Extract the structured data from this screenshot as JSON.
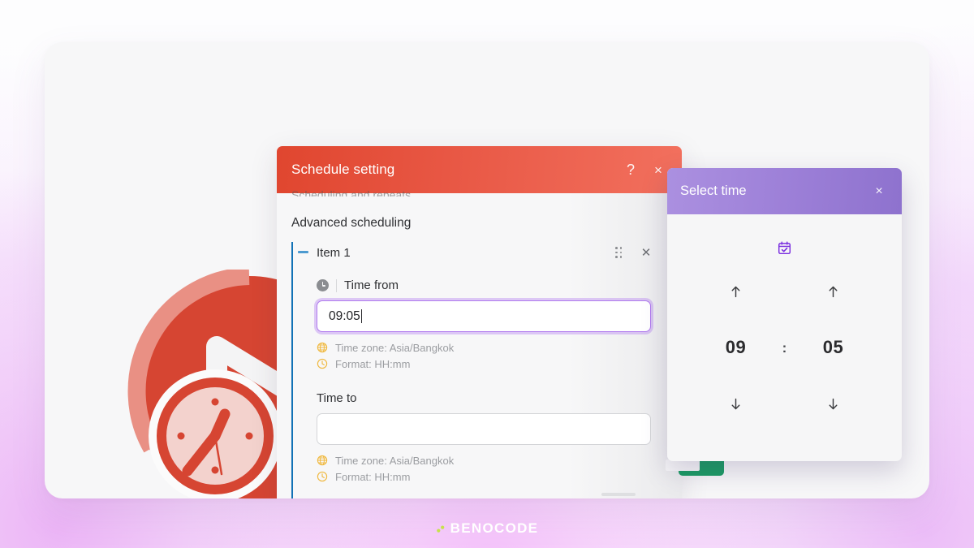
{
  "brand": {
    "name": "BENOCODE",
    "mark_icon": "benocode-dots-icon",
    "accent_color": "#c6e24a"
  },
  "background": {
    "logo_icon": "clock-logo-icon",
    "logo_color": "#d64532"
  },
  "schedule_dialog": {
    "title": "Schedule setting",
    "help_label": "?",
    "close_label": "×",
    "header_color_start": "#e0462f",
    "header_color_end": "#f2705e",
    "clipped_text": "Scheduling and repeats",
    "section_title": "Advanced scheduling",
    "item": {
      "label": "Item 1",
      "collapse_icon": "collapse-dash-icon",
      "drag_icon": "drag-handle-icon",
      "close_icon": "close-icon",
      "accent_color": "#1272b6"
    },
    "fields": [
      {
        "label": "Time from",
        "icon": "clock-icon",
        "value": "09:05",
        "placeholder": "",
        "focused": true,
        "helpers": [
          {
            "icon": "globe-icon",
            "text": "Time zone: Asia/Bangkok"
          },
          {
            "icon": "clock-outline-icon",
            "text": "Format: HH:mm"
          }
        ]
      },
      {
        "label": "Time to",
        "icon": "",
        "value": "",
        "placeholder": "",
        "focused": false,
        "helpers": [
          {
            "icon": "globe-icon",
            "text": "Time zone: Asia/Bangkok"
          },
          {
            "icon": "clock-outline-icon",
            "text": "Format: HH:mm"
          }
        ]
      }
    ]
  },
  "select_time_popup": {
    "title": "Select time",
    "close_label": "×",
    "header_color_start": "#ab90e0",
    "header_color_end": "#8e72ce",
    "calendar_icon": "calendar-check-icon",
    "calendar_icon_color": "#7b2fe0",
    "hour": {
      "value": "09",
      "increment_icon": "arrow-up-icon",
      "decrement_icon": "arrow-down-icon"
    },
    "separator": ":",
    "minute": {
      "value": "05",
      "increment_icon": "arrow-up-icon",
      "decrement_icon": "arrow-down-icon"
    }
  }
}
